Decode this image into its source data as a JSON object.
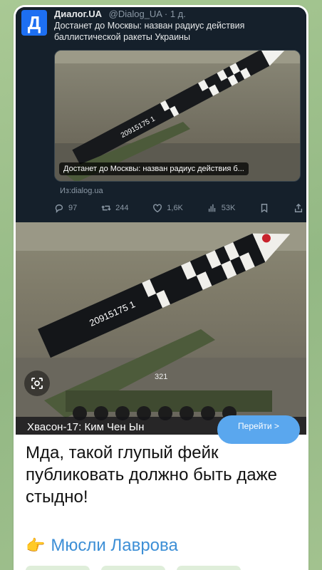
{
  "tweet": {
    "avatar_letter": "Д",
    "author": "Диалог.UA",
    "handle": "@Dialog_UA · 1 д.",
    "text": "Достанет до Москвы: назван радиус действия баллистической ракеты Украины",
    "card_caption": "Достанет до Москвы: назван радиус действия б...",
    "source": "Из:dialog.ua",
    "actions": {
      "replies": "97",
      "retweets": "244",
      "likes": "1,6K",
      "views": "53K"
    },
    "missile_markings": "20915175 1"
  },
  "photo": {
    "missile_markings": "20915175 1",
    "vehicle_number": "321"
  },
  "link_preview": {
    "title": "Хвасон-17: Ким Чен Ын",
    "open_button": "Перейти >"
  },
  "message": {
    "text": "Мда, такой глупый фейк публиковать должно быть даже стыдно!",
    "signature_emoji": "👉",
    "signature_link": "Мюсли Лаврова"
  },
  "colors": {
    "tweet_bg": "#15202b",
    "avatar": "#1d6ff2",
    "link_blue": "#3d8fd6",
    "open_button": "#5aa7ee",
    "chat_bg": "#9fc08e"
  }
}
